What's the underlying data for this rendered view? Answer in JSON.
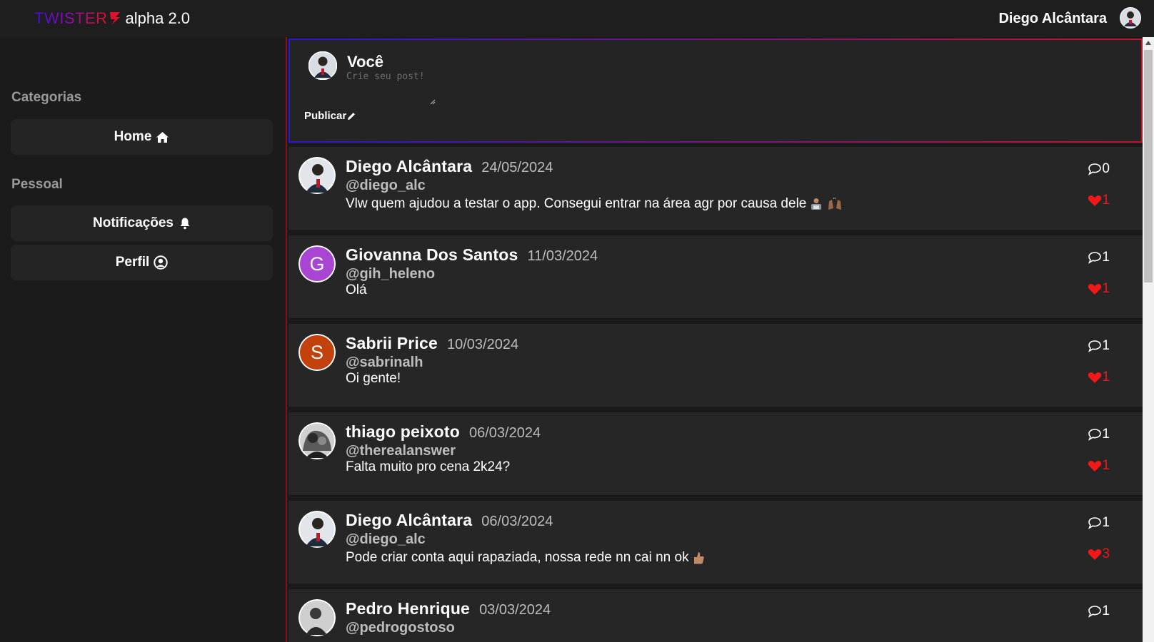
{
  "header": {
    "logo_text": "TWISTER",
    "version": "alpha 2.0",
    "user_name": "Diego Alcântara"
  },
  "sidebar": {
    "categories_heading": "Categorias",
    "home_label": "Home",
    "personal_heading": "Pessoal",
    "notifications_label": "Notificações",
    "profile_label": "Perfil"
  },
  "composer": {
    "author": "Você",
    "placeholder": "Crie seu post!",
    "publish_label": "Publicar"
  },
  "posts": [
    {
      "name": "Diego Alcântara",
      "date": "24/05/2024",
      "handle": "@diego_alc",
      "text": "Vlw quem ajudou a testar o app. Consegui entrar na área agr por causa dele",
      "comments": "0",
      "likes": "1",
      "avatar_type": "photo",
      "emojis": [
        "technologist-emoji",
        "raised-hands-emoji"
      ]
    },
    {
      "name": "Giovanna Dos Santos",
      "date": "11/03/2024",
      "handle": "@gih_heleno",
      "text": "Olá",
      "comments": "1",
      "likes": "1",
      "avatar_type": "letter",
      "avatar_letter": "G",
      "avatar_color": "#a845d2"
    },
    {
      "name": "Sabrii Price",
      "date": "10/03/2024",
      "handle": "@sabrinalh",
      "text": "Oi gente!",
      "comments": "1",
      "likes": "1",
      "avatar_type": "letter",
      "avatar_letter": "S",
      "avatar_color": "#c2410c"
    },
    {
      "name": "thiago peixoto",
      "date": "06/03/2024",
      "handle": "@therealanswer",
      "text": "Falta muito pro cena 2k24?",
      "comments": "1",
      "likes": "1",
      "avatar_type": "photo-bw"
    },
    {
      "name": "Diego Alcântara",
      "date": "06/03/2024",
      "handle": "@diego_alc",
      "text": "Pode criar conta aqui rapaziada, nossa rede nn cai nn ok",
      "comments": "1",
      "likes": "3",
      "avatar_type": "photo",
      "emojis": [
        "thumbs-up-emoji"
      ]
    },
    {
      "name": "Pedro Henrique",
      "date": "03/03/2024",
      "handle": "@pedrogostoso",
      "text": "",
      "comments": "1",
      "likes": "",
      "avatar_type": "photo-bw"
    }
  ],
  "colors": {
    "accent_blue": "#2a17d6",
    "accent_red": "#c5132a",
    "like_red": "#f01818"
  }
}
